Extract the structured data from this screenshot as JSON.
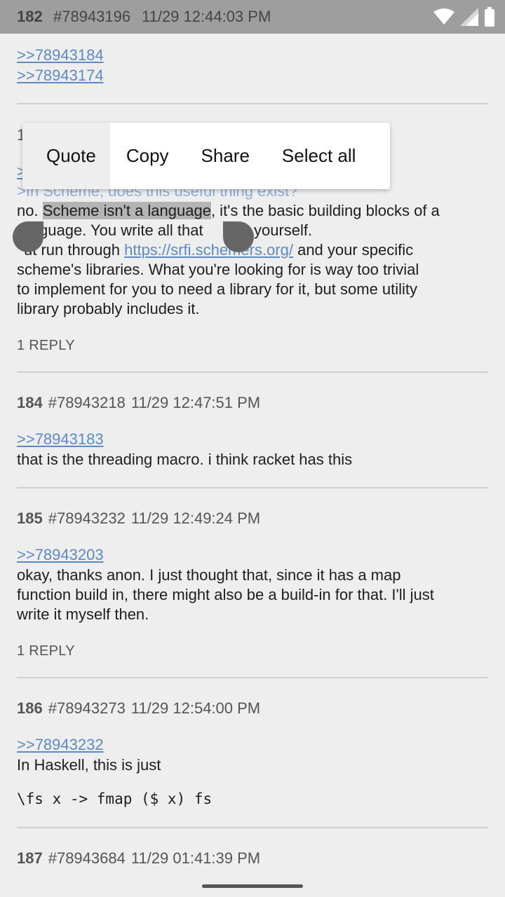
{
  "statusbar": {
    "post_num": "182",
    "post_id": "#78943196",
    "post_date": "11/29 12:44:03 PM",
    "icons": [
      "wifi-icon",
      "signal-icon",
      "battery-icon"
    ]
  },
  "post182": {
    "quote_links": [
      ">>78943184",
      ">>78943174"
    ]
  },
  "post183": {
    "num_partial": "1",
    "quote_partial": ">",
    "greentext": ">In Scheme, does this useful thing exist?",
    "line1_pre": "no. ",
    "line1_selected": "Scheme isn't a language",
    "line1_post": ", it's the basic building blocks of a",
    "line2": "guage. You write all that",
    "line2_end": "yourself.",
    "line3_pre": "ut run through ",
    "line3_link": "https://srfi.schemers.org/",
    "line3_post": " and your specific",
    "line4": "scheme's libraries. What you're looking for is way too trivial",
    "line5": "to implement for you to need a library for it, but some utility",
    "line6": "library probably includes it.",
    "replies": "1 REPLY"
  },
  "post184": {
    "num": "184",
    "id": "#78943218",
    "date": "11/29 12:47:51 PM",
    "quote": ">>78943183",
    "body": "that is the threading macro. i think racket has this"
  },
  "post185": {
    "num": "185",
    "id": "#78943232",
    "date": "11/29 12:49:24 PM",
    "quote": ">>78943203",
    "line1": "okay, thanks anon. I just thought that, since it has a map",
    "line2": "function build in, there might also be a build-in for that. I'll just",
    "line3": "write it myself then.",
    "replies": "1 REPLY"
  },
  "post186": {
    "num": "186",
    "id": "#78943273",
    "date": "11/29 12:54:00 PM",
    "quote": ">>78943232",
    "body": "In Haskell, this is just",
    "code": "\\fs x -> fmap ($ x) fs"
  },
  "post187": {
    "num": "187",
    "id": "#78943684",
    "date": "11/29 01:41:39 PM"
  },
  "context_menu": {
    "items": [
      "Quote",
      "Copy",
      "Share",
      "Select all"
    ]
  },
  "colors": {
    "background": "#eeeeee",
    "statusbar": "#9e9e9e",
    "link": "#5b8ac4",
    "selection": "#b4b4b4"
  }
}
